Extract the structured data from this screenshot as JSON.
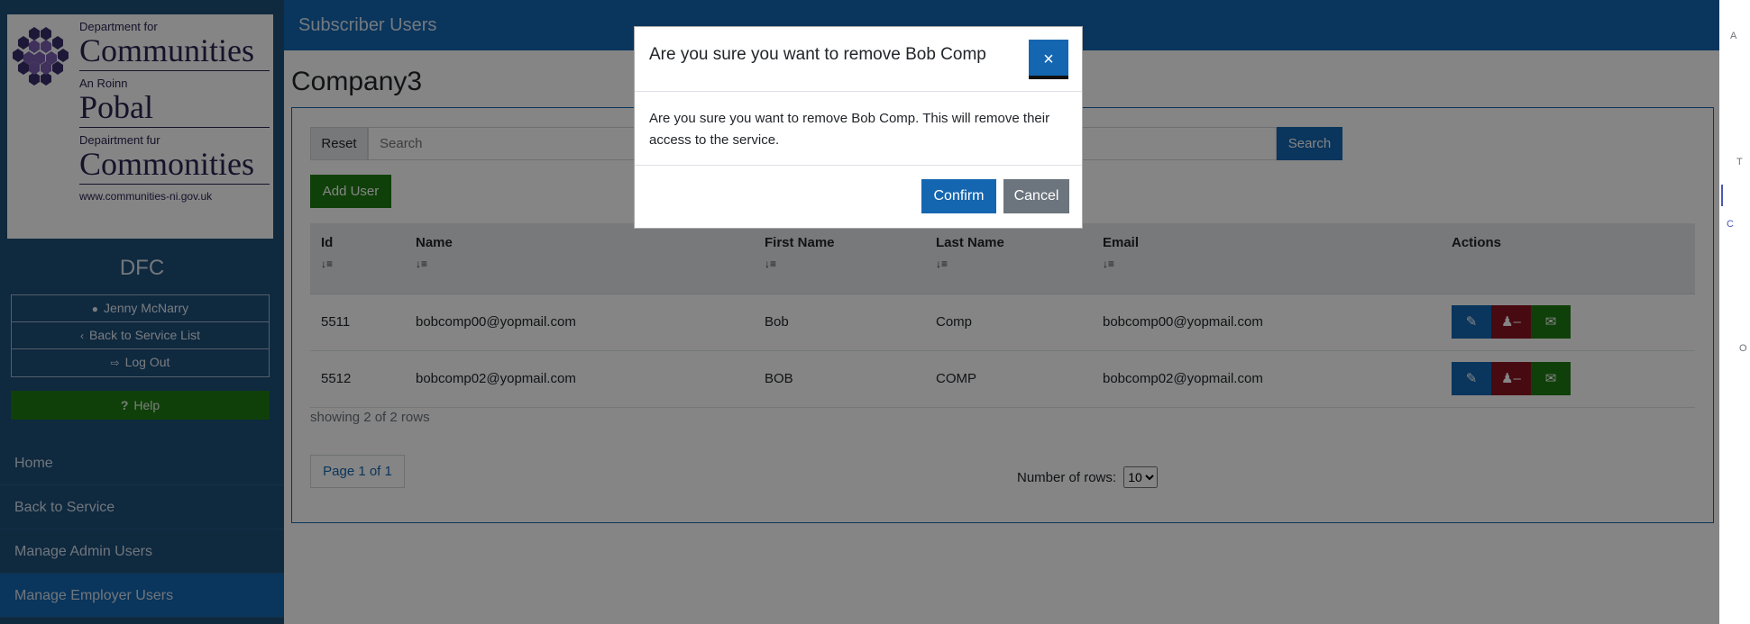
{
  "logo": {
    "line1": "Department for",
    "line2": "Communities",
    "line3": "An Roinn",
    "line4": "Pobal",
    "line5": "Depairtment fur",
    "line6": "Commonities",
    "url": "www.communities-ni.gov.uk"
  },
  "sidebar": {
    "org": "DFC",
    "user_name": "Jenny McNarry",
    "back_to_service_list": "Back to Service List",
    "log_out": "Log Out",
    "help": "Help",
    "nav": [
      {
        "label": "Home"
      },
      {
        "label": "Back to Service"
      },
      {
        "label": "Manage Admin Users"
      },
      {
        "label": "Manage Employer Users"
      }
    ]
  },
  "header": {
    "title": "Subscriber Users"
  },
  "main": {
    "company": "Company3",
    "reset_label": "Reset",
    "search_placeholder": "Search",
    "search_label": "Search",
    "add_user_label": "Add User",
    "table": {
      "columns": [
        "Id",
        "Name",
        "First Name",
        "Last Name",
        "Email",
        "Actions"
      ],
      "sort_glyph": "↓≡",
      "rows": [
        [
          "5511",
          "bobcomp00@yopmail.com",
          "Bob",
          "Comp",
          "bobcomp00@yopmail.com"
        ],
        [
          "5512",
          "bobcomp02@yopmail.com",
          "BOB",
          "COMP",
          "bobcomp02@yopmail.com"
        ]
      ]
    },
    "showing": "showing 2 of 2 rows",
    "pager": "Page 1 of 1",
    "rows_label": "Number of rows:",
    "rows_value": "10"
  },
  "right_strip": [
    "A",
    "T",
    "C",
    "O"
  ],
  "modal": {
    "title": "Are you sure you want to remove Bob Comp",
    "body": "Are you sure you want to remove Bob Comp. This will remove their access to the service.",
    "confirm": "Confirm",
    "cancel": "Cancel"
  },
  "colors": {
    "primary": "#1566b0",
    "sidebar": "#1d4f79",
    "success": "#1e7b12",
    "danger": "#8b1422",
    "secondary": "#6c757d"
  }
}
